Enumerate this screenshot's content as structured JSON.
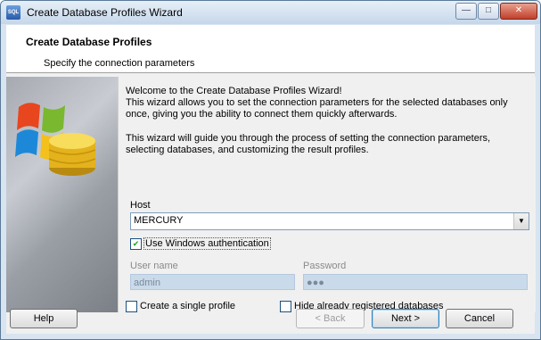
{
  "window": {
    "title": "Create Database Profiles Wizard",
    "icon_label": "SQL",
    "minimize_glyph": "—",
    "maximize_glyph": "□",
    "close_glyph": "✕"
  },
  "header": {
    "title": "Create Database Profiles",
    "subtitle": "Specify the connection parameters"
  },
  "intro": {
    "line1": "Welcome to the Create Database Profiles Wizard!",
    "line2": "This wizard allows you to set the connection parameters for the selected databases only once, giving you the ability to connect them quickly afterwards.",
    "line3": "This wizard will guide you through the process of setting the connection parameters, selecting databases, and customizing the result profiles."
  },
  "host": {
    "label": "Host",
    "value": "MERCURY"
  },
  "auth": {
    "checkbox_label": "Use Windows authentication",
    "checked": true
  },
  "credentials": {
    "username_label": "User name",
    "username_value": "admin",
    "password_label": "Password",
    "password_value": "●●●"
  },
  "options": {
    "single_profile_label": "Create a single profile",
    "hide_registered_label": "Hide already registered databases"
  },
  "buttons": {
    "help": "Help",
    "back": "< Back",
    "next": "Next >",
    "cancel": "Cancel"
  },
  "colors": {
    "title_bar": "#c6d7ea",
    "field_disabled": "#c9daea",
    "accent": "#3c7fb1"
  }
}
